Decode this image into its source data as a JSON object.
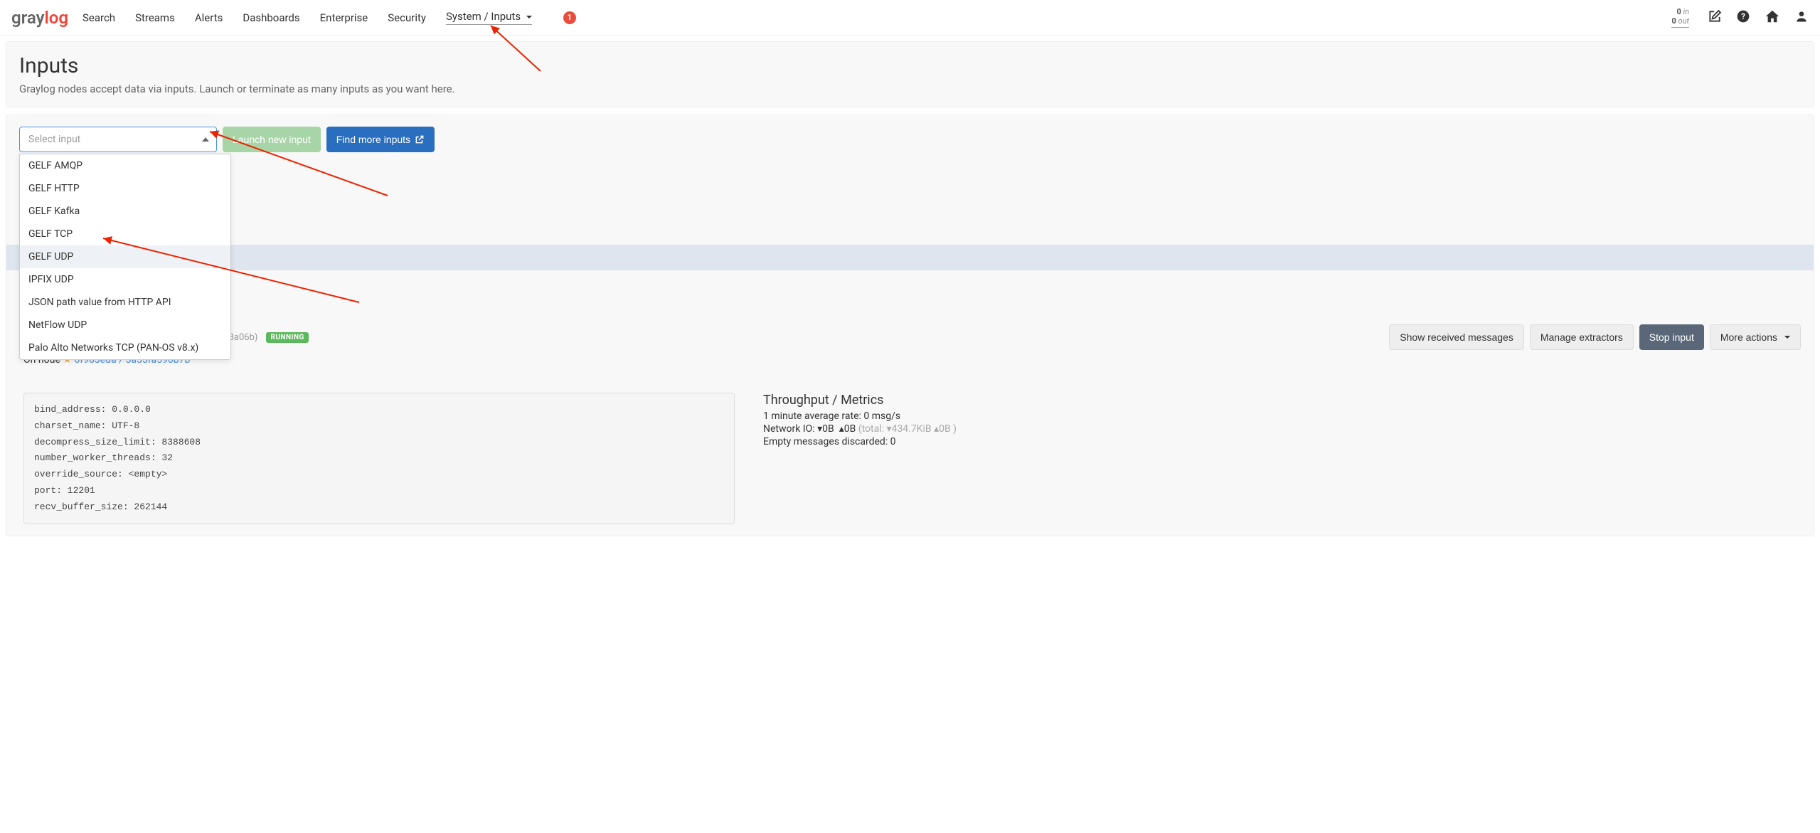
{
  "nav": {
    "items": [
      "Search",
      "Streams",
      "Alerts",
      "Dashboards",
      "Enterprise",
      "Security",
      "System / Inputs"
    ],
    "active_index": 6,
    "notification_count": "1"
  },
  "mini_throughput": {
    "in_val": "0",
    "in_label": "in",
    "out_val": "0",
    "out_label": "out"
  },
  "header": {
    "title": "Inputs",
    "subtitle": "Graylog nodes accept data via inputs. Launch or terminate as many inputs as you want here."
  },
  "toolbar": {
    "select_placeholder": "Select input",
    "launch_label": "Launch new input",
    "find_more_label": "Find more inputs"
  },
  "dropdown": {
    "items": [
      "GELF AMQP",
      "GELF HTTP",
      "GELF Kafka",
      "GELF TCP",
      "GELF UDP",
      "IPFIX UDP",
      "JSON path value from HTTP API",
      "NetFlow UDP",
      "Palo Alto Networks TCP (PAN-OS v8.x)"
    ],
    "highlight_index": 4
  },
  "input_instance": {
    "node_text_prefix": "On node",
    "node_link": "6f983eda / 5a55fa590b7b",
    "short_id": "338a06b)",
    "status": "RUNNING",
    "actions": {
      "show_messages": "Show received messages",
      "manage_extractors": "Manage extractors",
      "stop_input": "Stop input",
      "more_actions": "More actions"
    },
    "config": {
      "bind_address": "bind_address: 0.0.0.0",
      "charset_name": "charset_name: UTF-8",
      "decompress_size_limit": "decompress_size_limit: 8388608",
      "number_worker_threads": "number_worker_threads: 32",
      "override_source": "override_source: <empty>",
      "port": "port: 12201",
      "recv_buffer_size": "recv_buffer_size: 262144"
    },
    "metrics": {
      "title": "Throughput / Metrics",
      "avg_rate": "1 minute average rate: 0 msg/s",
      "net_label": "Network IO: ",
      "net_down": "0B",
      "net_up": "0B",
      "net_total": "(total: ▾434.7KiB  ▴0B )",
      "empty_discarded": "Empty messages discarded: 0"
    }
  }
}
